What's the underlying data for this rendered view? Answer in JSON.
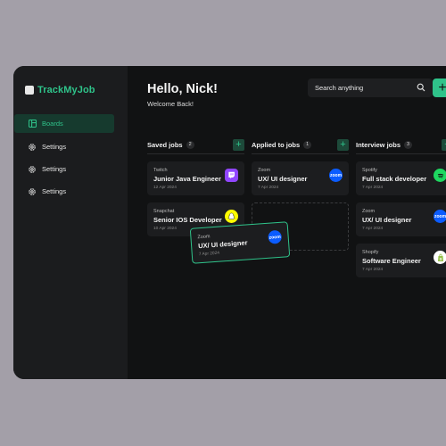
{
  "app": {
    "name": "TrackMyJob"
  },
  "sidebar": {
    "items": [
      {
        "label": "Boards",
        "icon": "board-icon",
        "active": true
      },
      {
        "label": "Settings",
        "icon": "gear-icon"
      },
      {
        "label": "Settings",
        "icon": "gear-icon"
      },
      {
        "label": "Settings",
        "icon": "gear-icon"
      }
    ]
  },
  "header": {
    "greeting": "Hello, Nick!",
    "subtitle": "Welcome Back!",
    "search_placeholder": "Search anything"
  },
  "columns": [
    {
      "title": "Saved jobs",
      "count": "2",
      "cards": [
        {
          "company": "Twitch",
          "role": "Junior Java Engineer",
          "date": "12 Apr 2024",
          "logo": "twitch-logo",
          "logo_color": "#9146ff"
        },
        {
          "company": "Snapchat",
          "role": "Senior IOS Developer",
          "date": "10 Apr 2024",
          "logo": "snapchat-logo",
          "logo_color": "#fffc00"
        }
      ]
    },
    {
      "title": "Applied to jobs",
      "count": "1",
      "cards": [
        {
          "company": "Zoom",
          "role": "UX/ UI designer",
          "date": "7 Apr 2024",
          "logo": "zoom",
          "logo_color": "#0b5cff"
        }
      ]
    },
    {
      "title": "Interview jobs",
      "count": "3",
      "cards": [
        {
          "company": "Spotify",
          "role": "Full stack developer",
          "date": "7 Apr 2024",
          "logo": "spotify-logo",
          "logo_color": "#1ed760"
        },
        {
          "company": "Zoom",
          "role": "UX/ UI designer",
          "date": "7 Apr 2024",
          "logo": "zoom",
          "logo_color": "#0b5cff"
        },
        {
          "company": "Shopify",
          "role": "Software Engineer",
          "date": "7 Apr 2024",
          "logo": "shopify-logo",
          "logo_color": "#95bf47"
        }
      ]
    }
  ],
  "dragging_card": {
    "company": "Zoom",
    "role": "UX/ UI designer",
    "date": "7 Apr 2024",
    "logo": "zoom",
    "logo_color": "#0b5cff"
  },
  "colors": {
    "accent": "#2fc38a",
    "background": "#111213",
    "sidebar": "#1b1c1e",
    "card": "#1c1d1f"
  }
}
